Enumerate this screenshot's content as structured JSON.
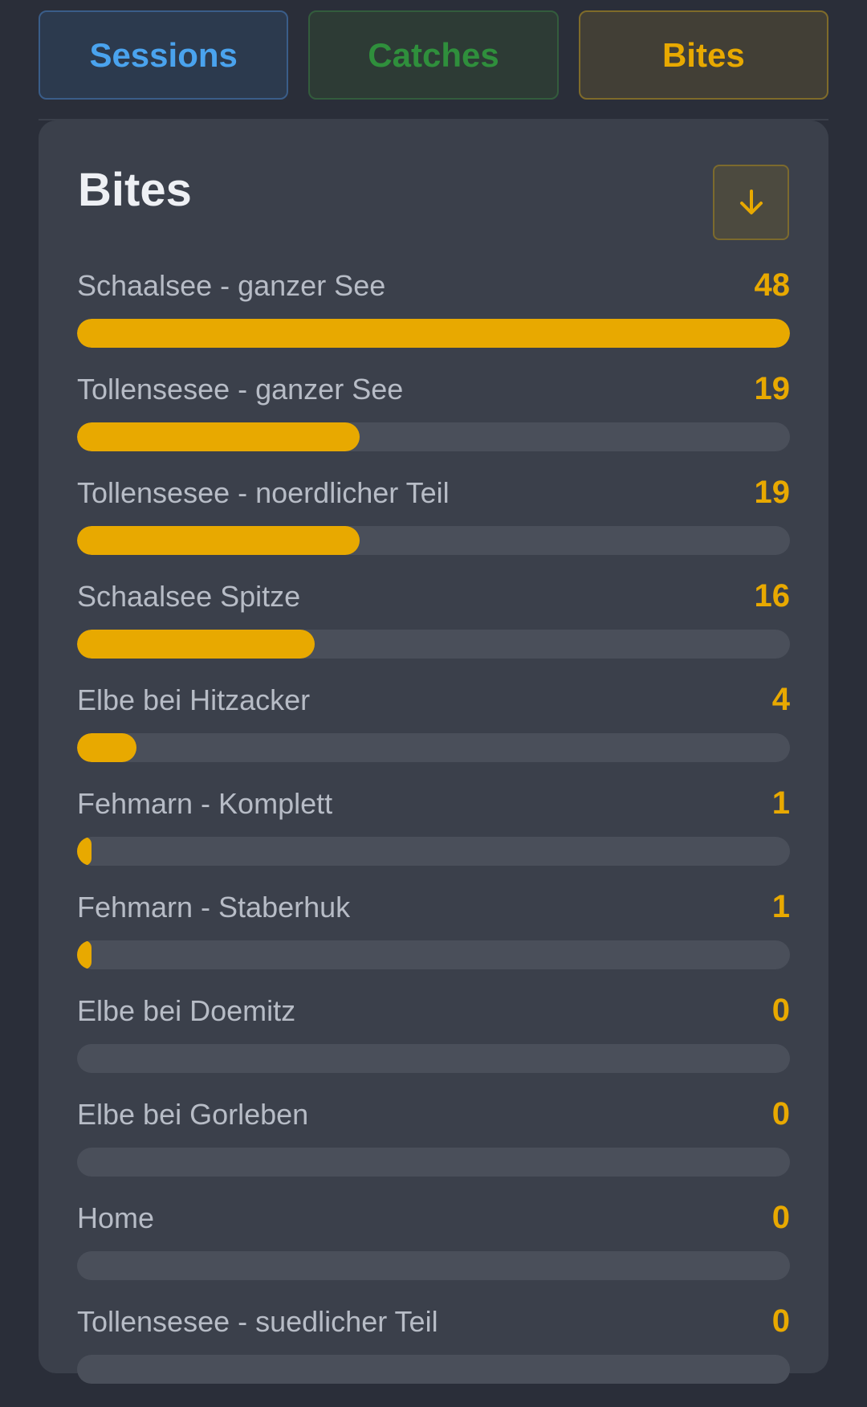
{
  "tabs": [
    {
      "label": "Sessions"
    },
    {
      "label": "Catches"
    },
    {
      "label": "Bites"
    }
  ],
  "panel": {
    "title": "Bites",
    "sort_icon": "arrow-down-icon"
  },
  "colors": {
    "accent": "#e8a900",
    "track": "#4a4f5a",
    "panel": "#3b404b",
    "background": "#2a2e39",
    "sessions": "#4aa3ee",
    "catches": "#2f8f3c"
  },
  "max_value": 48,
  "items": [
    {
      "label": "Schaalsee - ganzer See",
      "value": 48
    },
    {
      "label": "Tollensesee - ganzer See",
      "value": 19
    },
    {
      "label": "Tollensesee - noerdlicher Teil",
      "value": 19
    },
    {
      "label": "Schaalsee Spitze",
      "value": 16
    },
    {
      "label": "Elbe bei Hitzacker",
      "value": 4
    },
    {
      "label": "Fehmarn - Komplett",
      "value": 1
    },
    {
      "label": "Fehmarn - Staberhuk",
      "value": 1
    },
    {
      "label": "Elbe bei Doemitz",
      "value": 0
    },
    {
      "label": "Elbe bei Gorleben",
      "value": 0
    },
    {
      "label": "Home",
      "value": 0
    },
    {
      "label": "Tollensesee - suedlicher Teil",
      "value": 0
    }
  ]
}
